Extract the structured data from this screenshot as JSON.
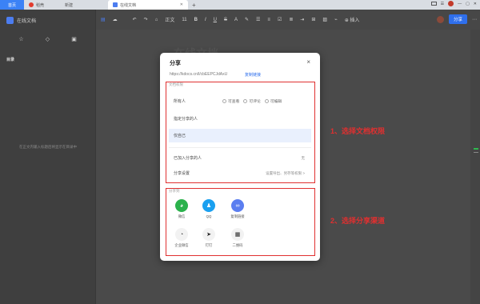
{
  "browser": {
    "tabs": [
      {
        "label": "首页"
      },
      {
        "label": "稻壳"
      },
      {
        "label": "新建"
      },
      {
        "label": "在线文档"
      }
    ],
    "new_tab_symbol": "+"
  },
  "sidebar": {
    "title": "在线文档",
    "section": "目录",
    "empty_hint": "在正文内输入标题后将显示在目录中"
  },
  "toolbar": {
    "style_label": "正文",
    "font_size": "11",
    "insert_label": "插入",
    "share_label": "分享"
  },
  "document": {
    "title": "在线文档"
  },
  "share_dialog": {
    "title": "分享",
    "close": "×",
    "link": "https://kdocs.cn/l/cbEEPCJdAxU",
    "copy_link": "复制链接",
    "permission_section": "文档权限",
    "rows": [
      {
        "label": "所有人"
      },
      {
        "label": "指定分享的人"
      },
      {
        "label": "仅自己"
      },
      {
        "label": "已加入分享的人",
        "value": "无"
      },
      {
        "label": "分享设置",
        "value": "设置导出、另存等权限 >"
      }
    ],
    "radio_options": [
      "可查看",
      "可评论",
      "可编辑"
    ],
    "channel_section": "分享到",
    "channels": [
      {
        "label": "微信",
        "icon": "wechat-icon",
        "color": "#2bb24c"
      },
      {
        "label": "QQ",
        "icon": "qq-icon",
        "color": "#1aa0f0"
      },
      {
        "label": "复制链接",
        "icon": "link-icon",
        "color": "#5b7ef0"
      },
      {
        "label": "企业微信",
        "icon": "wecom-icon",
        "color": "#ffffff"
      },
      {
        "label": "钉钉",
        "icon": "dingtalk-icon",
        "color": "#ffffff"
      },
      {
        "label": "二维码",
        "icon": "qrcode-icon",
        "color": "#ffffff"
      }
    ]
  },
  "annotations": {
    "step1": "1、选择文档权限",
    "step2": "2、选择分享渠道"
  }
}
